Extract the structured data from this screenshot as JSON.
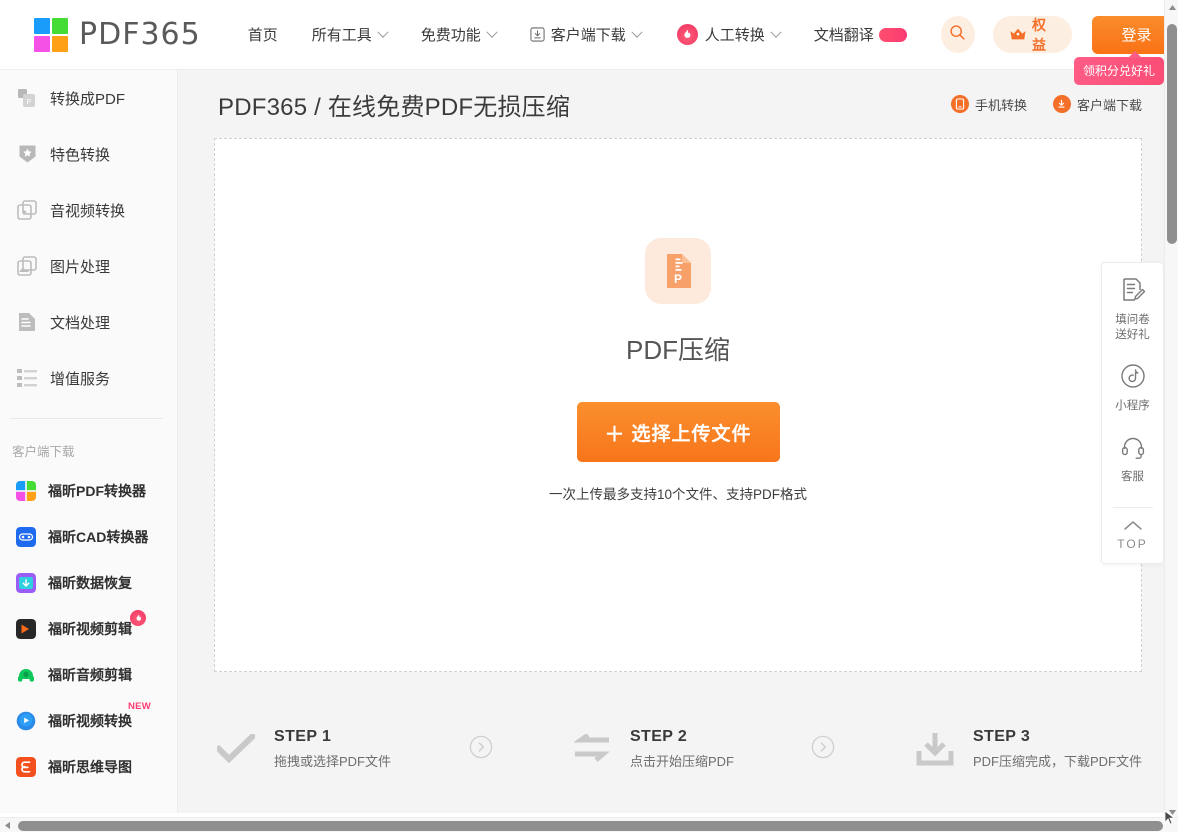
{
  "header": {
    "logo_text": "PDF365",
    "nav": [
      {
        "label": "首页",
        "has_caret": false,
        "icon": "",
        "hot": false
      },
      {
        "label": "所有工具",
        "has_caret": true,
        "icon": "",
        "hot": false
      },
      {
        "label": "免费功能",
        "has_caret": true,
        "icon": "",
        "hot": false
      },
      {
        "label": "客户端下载",
        "has_caret": true,
        "icon": "download-box-icon",
        "hot": false
      },
      {
        "label": "人工转换",
        "has_caret": true,
        "icon": "flame-icon",
        "hot": false
      },
      {
        "label": "文档翻译",
        "has_caret": false,
        "icon": "",
        "hot": true
      }
    ],
    "search_icon": "search-icon",
    "benefit_label": "权益",
    "benefit_icon": "crown-icon",
    "login_label": "登录",
    "login_tip": "领积分兑好礼"
  },
  "sidebar": {
    "items": [
      {
        "label": "转换成PDF",
        "icon": "convert-to-pdf-icon"
      },
      {
        "label": "特色转换",
        "icon": "star-shield-icon"
      },
      {
        "label": "音视频转换",
        "icon": "media-convert-icon"
      },
      {
        "label": "图片处理",
        "icon": "image-process-icon"
      },
      {
        "label": "文档处理",
        "icon": "document-process-icon"
      },
      {
        "label": "增值服务",
        "icon": "value-added-icon"
      }
    ],
    "section_title": "客户端下载",
    "apps": [
      {
        "label": "福昕PDF转换器",
        "icon": "foxit-pdf-icon",
        "badge": ""
      },
      {
        "label": "福昕CAD转换器",
        "icon": "foxit-cad-icon",
        "badge": ""
      },
      {
        "label": "福昕数据恢复",
        "icon": "foxit-recovery-icon",
        "badge": ""
      },
      {
        "label": "福昕视频剪辑",
        "icon": "foxit-video-edit-icon",
        "badge": "hot"
      },
      {
        "label": "福昕音频剪辑",
        "icon": "foxit-audio-edit-icon",
        "badge": ""
      },
      {
        "label": "福昕视频转换",
        "icon": "foxit-video-convert-icon",
        "badge": "NEW"
      },
      {
        "label": "福昕思维导图",
        "icon": "foxit-mindmap-icon",
        "badge": ""
      }
    ]
  },
  "main": {
    "page_title": "PDF365 / 在线免费PDF无损压缩",
    "head_links": [
      {
        "label": "手机转换",
        "icon": "phone-icon"
      },
      {
        "label": "客户端下载",
        "icon": "download-icon"
      }
    ],
    "dropzone": {
      "file_icon": "pdf-compress-file-icon",
      "title": "PDF压缩",
      "upload_button": "选择上传文件",
      "upload_plus": "＋",
      "hint": "一次上传最多支持10个文件、支持PDF格式"
    },
    "steps": [
      {
        "title": "STEP 1",
        "desc": "拖拽或选择PDF文件",
        "icon": "check-icon"
      },
      {
        "title": "STEP 2",
        "desc": "点击开始压缩PDF",
        "icon": "swap-icon"
      },
      {
        "title": "STEP 3",
        "desc": "PDF压缩完成，下载PDF文件",
        "icon": "download-tray-icon"
      }
    ],
    "step_arrow_icon": "chevron-right-circle-icon"
  },
  "rail": {
    "items": [
      {
        "label": "填问卷\n送好礼",
        "line1": "填问卷",
        "line2": "送好礼",
        "icon": "survey-icon"
      },
      {
        "label": "小程序",
        "line1": "小程序",
        "line2": "",
        "icon": "miniprogram-icon"
      },
      {
        "label": "客服",
        "line1": "客服",
        "line2": "",
        "icon": "headset-icon"
      }
    ],
    "top_label": "TOP",
    "top_icon": "chevron-up-icon"
  },
  "colors": {
    "accent_orange": "#f4702a",
    "accent_orange_soft": "#fdeee2",
    "pink": "#fb4d76",
    "page_bg": "#f4f4f4"
  }
}
